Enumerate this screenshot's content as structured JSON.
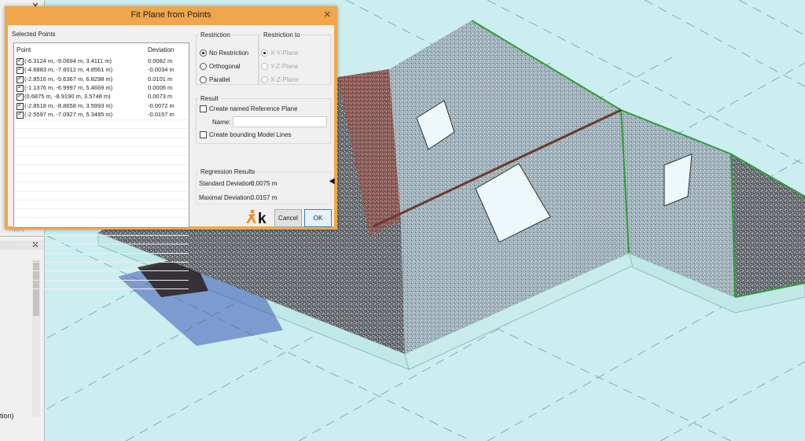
{
  "dialog": {
    "title": "Fit Plane from Points",
    "close_glyph": "✕",
    "selected_points_label": "Selected Points",
    "columns": {
      "point": "Point",
      "deviation": "Deviation"
    },
    "rows": [
      {
        "point": "(-6.3124 m, -9.0694 m, 3.4111 m)",
        "deviation": "0.0082 m",
        "checked": true
      },
      {
        "point": "(-4.6883 m, -7.6012 m, 4.8561 m)",
        "deviation": "-0.0034 m",
        "checked": true
      },
      {
        "point": "(-2.8516 m, -5.6367 m, 6.8298 m)",
        "deviation": "0.0101 m",
        "checked": true
      },
      {
        "point": "(-1.1376 m, -6.9997 m, 5.4669 m)",
        "deviation": "0.0006 m",
        "checked": true
      },
      {
        "point": "(0.6875 m, -8.9190 m, 3.5748 m)",
        "deviation": "0.0073 m",
        "checked": true
      },
      {
        "point": "(-2.8518 m, -8.8658 m, 3.5993 m)",
        "deviation": "-0.0072 m",
        "checked": true
      },
      {
        "point": "(-2.5597 m, -7.0927 m, 5.3485 m)",
        "deviation": "-0.0157 m",
        "checked": true
      }
    ],
    "restriction": {
      "label": "Restriction",
      "options": [
        "No Restriction",
        "Orthogonal",
        "Parallel"
      ],
      "selected": "No Restriction"
    },
    "restriction_to": {
      "label": "Restriction to",
      "options": [
        "X-Y-Plane",
        "Y-Z-Plane",
        "X-Z-Plane"
      ],
      "selected": "X-Y-Plane"
    },
    "result": {
      "label": "Result",
      "create_ref_plane": "Create named Reference Plane",
      "name_label": "Name:",
      "name_value": "",
      "create_model_lines": "Create bounding Model Lines"
    },
    "regression": {
      "label": "Regression Results",
      "std_label": "Standard Deviation:",
      "std_value": "0.0075 m",
      "max_label": "Maximal Deviation:",
      "max_value": "0.0157 m"
    },
    "logo_text": "k",
    "cancel_label": "Cancel",
    "ok_label": "OK"
  },
  "left_panel": {
    "close_glyph": "✕",
    "apply_label": "Apply",
    "bottom_text": "tion)"
  },
  "colors": {
    "dialog_frame": "#f0a64a",
    "model_edge": "#2f9c3a",
    "floor_slab": "#bfe8e6",
    "sky": "#cdeef0"
  }
}
